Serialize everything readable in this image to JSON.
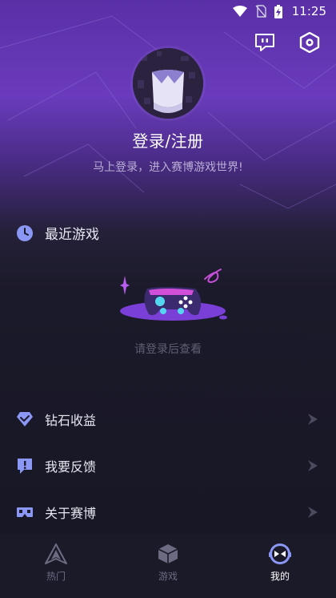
{
  "status_bar": {
    "time": "11:25"
  },
  "profile": {
    "login_label": "登录/注册",
    "subtitle": "马上登录，进入赛博游戏世界!"
  },
  "recent": {
    "title": "最近游戏",
    "empty_text": "请登录后查看"
  },
  "menu": [
    {
      "label": "钻石收益",
      "icon": "diamond-icon"
    },
    {
      "label": "我要反馈",
      "icon": "feedback-icon"
    },
    {
      "label": "关于赛博",
      "icon": "vr-headset-icon"
    }
  ],
  "bottom_nav": [
    {
      "label": "热门",
      "icon": "hot-triangle-icon",
      "active": false
    },
    {
      "label": "游戏",
      "icon": "cube-icon",
      "active": false
    },
    {
      "label": "我的",
      "icon": "mine-mask-icon",
      "active": true
    }
  ],
  "colors": {
    "accent": "#7b8cf7",
    "header_purple": "#6a3bbd",
    "background": "#171624",
    "nav_background": "#1b1a29"
  }
}
